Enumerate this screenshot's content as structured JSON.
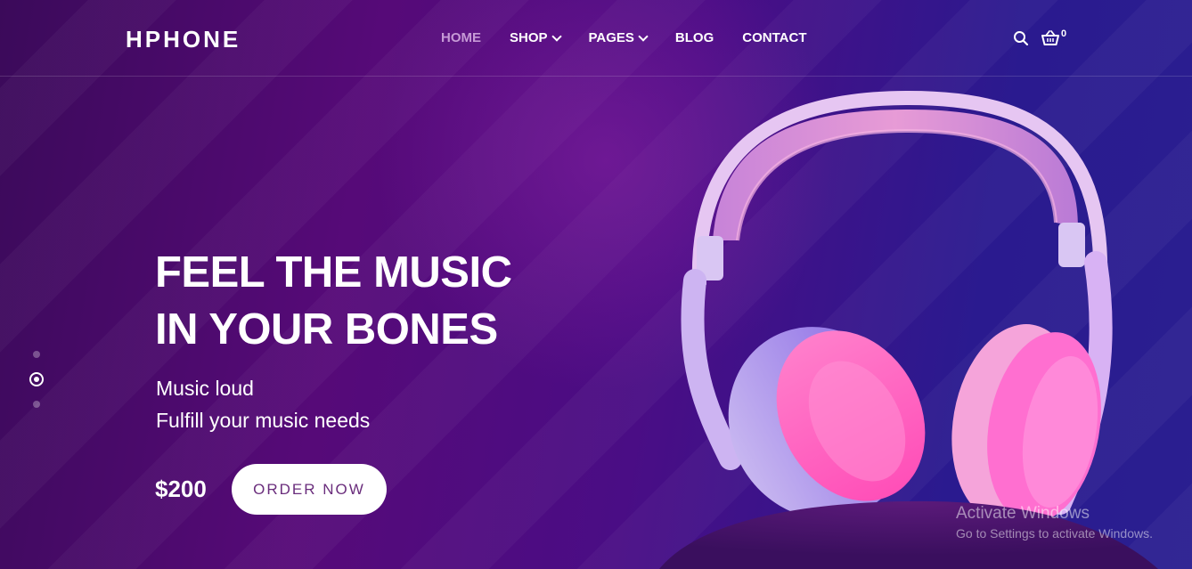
{
  "brand": {
    "logo": "HPHONE"
  },
  "nav": {
    "items": [
      {
        "label": "HOME",
        "active": true,
        "has_dropdown": false
      },
      {
        "label": "SHOP",
        "active": false,
        "has_dropdown": true
      },
      {
        "label": "PAGES",
        "active": false,
        "has_dropdown": true
      },
      {
        "label": "BLOG",
        "active": false,
        "has_dropdown": false
      },
      {
        "label": "CONTACT",
        "active": false,
        "has_dropdown": false
      }
    ],
    "icons": [
      "search-icon",
      "basket-icon"
    ],
    "cart_count": "0"
  },
  "hero": {
    "title_line1": "FEEL THE MUSIC",
    "title_line2": "IN YOUR BONES",
    "subtitle_line1": "Music loud",
    "subtitle_line2": "Fulfill your music needs",
    "price": "$200",
    "cta_label": "ORDER NOW",
    "slide_count": 3,
    "active_slide": 2
  },
  "watermark": {
    "line1": "Activate Windows",
    "line2": "Go to Settings to activate Windows."
  },
  "colors": {
    "accent_active_nav": "#c69ad6",
    "button_text": "#6a2d7c",
    "bg_left": "#3b0a5a",
    "bg_right": "#2a1f90"
  }
}
